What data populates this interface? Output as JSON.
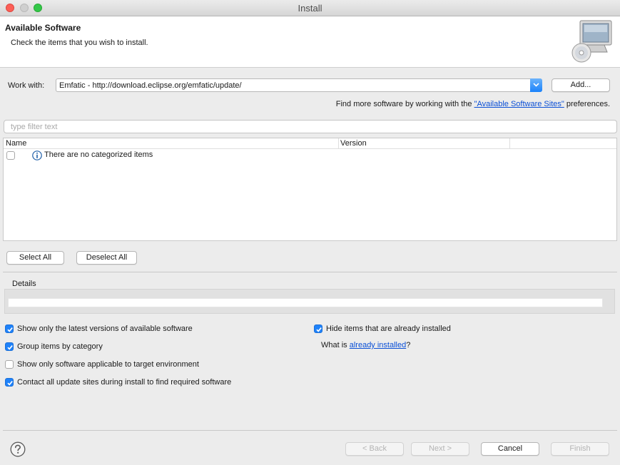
{
  "window": {
    "title": "Install"
  },
  "header": {
    "title": "Available Software",
    "subtitle": "Check the items that you wish to install."
  },
  "work_with": {
    "label": "Work with:",
    "value": "Emfatic - http://download.eclipse.org/emfatic/update/",
    "add_button": "Add..."
  },
  "find_more": {
    "prefix": "Find more software by working with the ",
    "link": "\"Available Software Sites\"",
    "suffix": " preferences."
  },
  "filter": {
    "placeholder": "type filter text"
  },
  "table": {
    "columns": [
      "Name",
      "Version"
    ],
    "rows": [
      {
        "label": "There are no categorized items",
        "icon": "info-icon",
        "checked": false
      }
    ]
  },
  "selection_buttons": {
    "select_all": "Select All",
    "deselect_all": "Deselect All"
  },
  "details": {
    "label": "Details"
  },
  "options": {
    "left": [
      {
        "label": "Show only the latest versions of available software",
        "checked": true
      },
      {
        "label": "Group items by category",
        "checked": true
      },
      {
        "label": "Show only software applicable to target environment",
        "checked": false
      },
      {
        "label": "Contact all update sites during install to find required software",
        "checked": true
      }
    ],
    "right": [
      {
        "label": "Hide items that are already installed",
        "checked": true
      }
    ],
    "installed_prefix": "What is ",
    "installed_link": "already installed",
    "installed_suffix": "?"
  },
  "footer": {
    "back": "< Back",
    "next": "Next >",
    "cancel": "Cancel",
    "finish": "Finish",
    "back_enabled": false,
    "next_enabled": false,
    "finish_enabled": false
  },
  "colors": {
    "accent": "#1f82f9",
    "link": "#0a4fd6"
  }
}
